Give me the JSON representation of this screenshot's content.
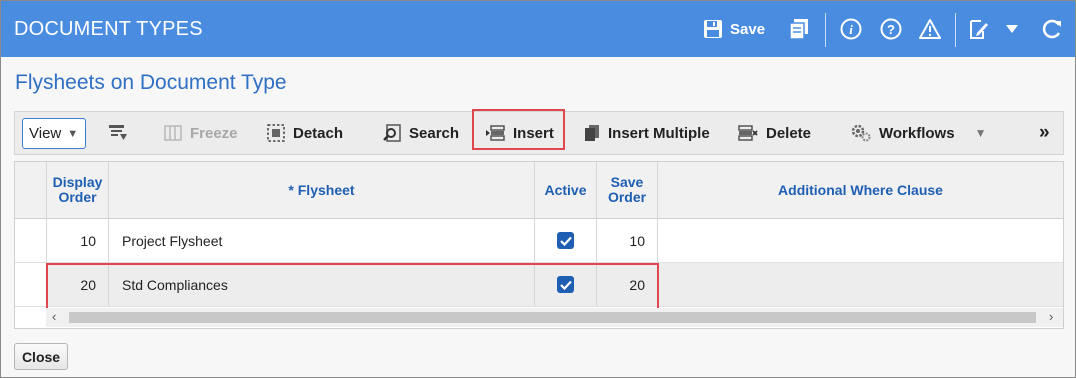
{
  "window": {
    "title": "DOCUMENT TYPES"
  },
  "titlebar": {
    "save_label": "Save",
    "icons": [
      "save-icon",
      "copy-icon",
      "info-icon",
      "help-icon",
      "warning-icon",
      "edit-icon",
      "chevron-down-icon",
      "refresh-icon"
    ]
  },
  "section": {
    "title": "Flysheets on Document Type"
  },
  "toolbar": {
    "view_label": "View",
    "freeze_label": "Freeze",
    "detach_label": "Detach",
    "search_label": "Search",
    "insert_label": "Insert",
    "insert_multiple_label": "Insert Multiple",
    "delete_label": "Delete",
    "workflows_label": "Workflows",
    "more_label": "»"
  },
  "grid": {
    "columns": [
      {
        "label": "Display Order"
      },
      {
        "label": "* Flysheet"
      },
      {
        "label": "Active"
      },
      {
        "label": "Save Order"
      },
      {
        "label": "Additional Where Clause"
      }
    ],
    "rows": [
      {
        "display_order": "10",
        "flysheet": "Project Flysheet",
        "active": true,
        "save_order": "10",
        "where_clause": ""
      },
      {
        "display_order": "20",
        "flysheet": "Std Compliances",
        "active": true,
        "save_order": "20",
        "where_clause": ""
      }
    ]
  },
  "footer": {
    "close_label": "Close"
  },
  "colors": {
    "titlebar": "#4a8de0",
    "accent": "#1f5fb3",
    "highlight": "#e0474c"
  }
}
